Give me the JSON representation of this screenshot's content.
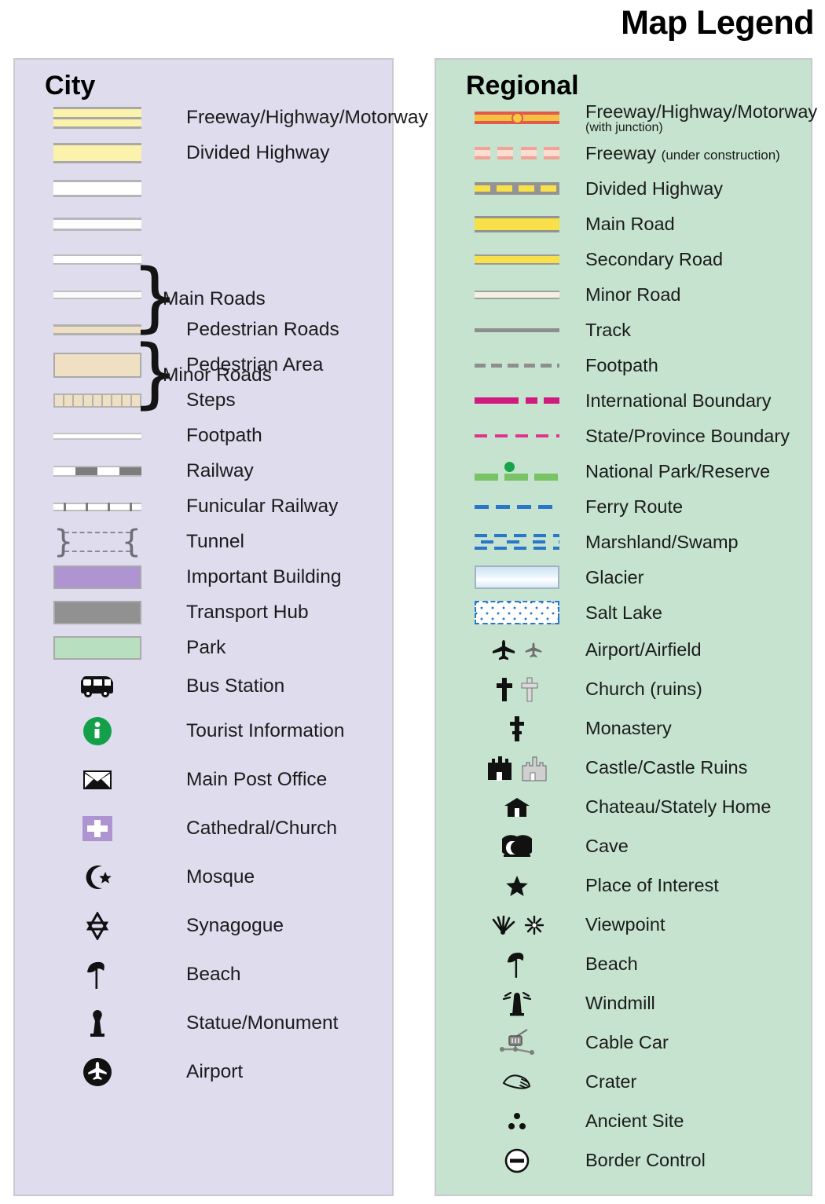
{
  "header": {
    "title": "Map Legend"
  },
  "city": {
    "title": "City",
    "group_labels": {
      "main_roads": "Main Roads",
      "minor_roads": "Minor Roads"
    },
    "items": [
      {
        "label": "Freeway/Highway/Motorway",
        "symbol": "freeway-band",
        "color": "#fbf3ab"
      },
      {
        "label": "Divided Highway",
        "symbol": "divided-highway-band",
        "color": "#fbf3ab"
      },
      {
        "label": "",
        "symbol": "main-road-thick",
        "color": "#ffffff"
      },
      {
        "label": "",
        "symbol": "main-road-mid",
        "color": "#ffffff"
      },
      {
        "label": "",
        "symbol": "minor-road-thin",
        "color": "#ffffff"
      },
      {
        "label": "",
        "symbol": "minor-road-thinner",
        "color": "#fafafa"
      },
      {
        "label": "Pedestrian Roads",
        "symbol": "pedestrian-road-band",
        "color": "#efdfc3"
      },
      {
        "label": "Pedestrian Area",
        "symbol": "pedestrian-area-block",
        "color": "#efdfc3"
      },
      {
        "label": "Steps",
        "symbol": "steps-band",
        "color": "#efdfc3"
      },
      {
        "label": "Footpath",
        "symbol": "footpath-line",
        "color": "#ffffff"
      },
      {
        "label": "Railway",
        "symbol": "railway-dashed-band",
        "color": "#7d7d7d"
      },
      {
        "label": "Funicular Railway",
        "symbol": "funicular-tick-band",
        "color": "#7d7d7d"
      },
      {
        "label": "Tunnel",
        "symbol": "tunnel-brackets",
        "color": "#8a8a92"
      },
      {
        "label": "Important Building",
        "symbol": "building-block",
        "color": "#ae94d0"
      },
      {
        "label": "Transport Hub",
        "symbol": "transport-hub-block",
        "color": "#919191"
      },
      {
        "label": "Park",
        "symbol": "park-block",
        "color": "#b9dfc1"
      },
      {
        "label": "Bus Station",
        "symbol": "bus-icon",
        "color": "#111111"
      },
      {
        "label": "Tourist Information",
        "symbol": "information-icon",
        "color": "#14a04a"
      },
      {
        "label": "Main Post Office",
        "symbol": "envelope-icon",
        "color": "#111111"
      },
      {
        "label": "Cathedral/Church",
        "symbol": "church-cross-icon",
        "color": "#ae94d0"
      },
      {
        "label": "Mosque",
        "symbol": "crescent-star-icon",
        "color": "#111111"
      },
      {
        "label": "Synagogue",
        "symbol": "star-of-david-icon",
        "color": "#111111"
      },
      {
        "label": "Beach",
        "symbol": "beach-umbrella-icon",
        "color": "#111111"
      },
      {
        "label": "Statue/Monument",
        "symbol": "statue-icon",
        "color": "#111111"
      },
      {
        "label": "Airport",
        "symbol": "airport-circle-icon",
        "color": "#111111"
      }
    ]
  },
  "regional": {
    "title": "Regional",
    "items": [
      {
        "label": "Freeway/Highway/Motorway",
        "sublabel": "(with junction)",
        "symbol": "freeway-junction-line",
        "color": "#e05a50"
      },
      {
        "label": "Freeway",
        "inline_note": "(under construction)",
        "symbol": "freeway-construction-dashes",
        "color": "#f4a295"
      },
      {
        "label": "Divided Highway",
        "symbol": "divided-highway-line",
        "color": "#f7e04a"
      },
      {
        "label": "Main Road",
        "symbol": "main-road-line",
        "color": "#f7e04a"
      },
      {
        "label": "Secondary Road",
        "symbol": "secondary-road-line",
        "color": "#f7e04a"
      },
      {
        "label": "Minor Road",
        "symbol": "minor-road-line",
        "color": "#f5f1e0"
      },
      {
        "label": "Track",
        "symbol": "track-line",
        "color": "#8e8e8e"
      },
      {
        "label": "Footpath",
        "symbol": "footpath-dashed-line",
        "color": "#8e8e8e"
      },
      {
        "label": "International Boundary",
        "symbol": "international-boundary-line",
        "color": "#d11a7f"
      },
      {
        "label": "State/Province Boundary",
        "symbol": "state-boundary-line",
        "color": "#e0338c"
      },
      {
        "label": "National Park/Reserve",
        "symbol": "national-park-line",
        "color": "#79c367"
      },
      {
        "label": "Ferry Route",
        "symbol": "ferry-route-line",
        "color": "#2a77c9"
      },
      {
        "label": "Marshland/Swamp",
        "symbol": "marshland-pattern",
        "color": "#2a77c9"
      },
      {
        "label": "Glacier",
        "symbol": "glacier-block",
        "color": "#cfe3f2"
      },
      {
        "label": "Salt Lake",
        "symbol": "salt-lake-block",
        "color": "#2a77c9"
      },
      {
        "label": "Airport/Airfield",
        "symbol": "airplane-icon",
        "color": "#111111"
      },
      {
        "label": "Church (ruins)",
        "symbol": "church-cross-icon",
        "color": "#111111"
      },
      {
        "label": "Monastery",
        "symbol": "monastery-cross-icon",
        "color": "#111111"
      },
      {
        "label": "Castle/Castle Ruins",
        "symbol": "castle-icon",
        "color": "#111111"
      },
      {
        "label": "Chateau/Stately Home",
        "symbol": "chateau-icon",
        "color": "#111111"
      },
      {
        "label": "Cave",
        "symbol": "cave-icon",
        "color": "#111111"
      },
      {
        "label": "Place of Interest",
        "symbol": "star-icon",
        "color": "#111111"
      },
      {
        "label": "Viewpoint",
        "symbol": "viewpoint-icon",
        "color": "#111111"
      },
      {
        "label": "Beach",
        "symbol": "beach-umbrella-icon",
        "color": "#111111"
      },
      {
        "label": "Windmill",
        "symbol": "windmill-icon",
        "color": "#111111"
      },
      {
        "label": "Cable Car",
        "symbol": "cable-car-icon",
        "color": "#6f6f6f"
      },
      {
        "label": "Crater",
        "symbol": "crater-icon",
        "color": "#111111"
      },
      {
        "label": "Ancient Site",
        "symbol": "ancient-site-icon",
        "color": "#111111"
      },
      {
        "label": "Border Control",
        "symbol": "border-control-icon",
        "color": "#111111"
      }
    ]
  }
}
